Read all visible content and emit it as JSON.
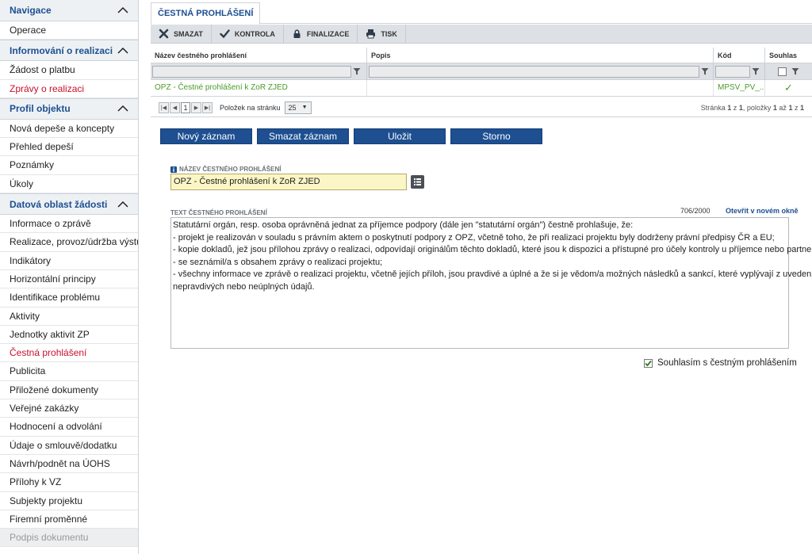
{
  "sidebar": {
    "sections": [
      {
        "title": "Navigace",
        "items": [
          {
            "label": "Operace",
            "state": "normal"
          }
        ]
      },
      {
        "title": "Informování o realizaci",
        "items": [
          {
            "label": "Žádost o platbu",
            "state": "normal"
          },
          {
            "label": "Zprávy o realizaci",
            "state": "active"
          }
        ]
      },
      {
        "title": "Profil objektu",
        "items": [
          {
            "label": "Nová depeše a koncepty",
            "state": "normal"
          },
          {
            "label": "Přehled depeší",
            "state": "normal"
          },
          {
            "label": "Poznámky",
            "state": "normal"
          },
          {
            "label": "Úkoly",
            "state": "normal"
          }
        ]
      },
      {
        "title": "Datová oblast žádosti",
        "items": [
          {
            "label": "Informace o zprávě",
            "state": "normal"
          },
          {
            "label": "Realizace, provoz/údržba výstupu",
            "state": "normal"
          },
          {
            "label": "Indikátory",
            "state": "normal"
          },
          {
            "label": "Horizontální principy",
            "state": "normal"
          },
          {
            "label": "Identifikace problému",
            "state": "normal"
          },
          {
            "label": "Aktivity",
            "state": "normal"
          },
          {
            "label": "Jednotky aktivit ZP",
            "state": "normal"
          },
          {
            "label": "Čestná prohlášení",
            "state": "active"
          },
          {
            "label": "Publicita",
            "state": "normal"
          },
          {
            "label": "Přiložené dokumenty",
            "state": "normal"
          },
          {
            "label": "Veřejné zakázky",
            "state": "normal"
          },
          {
            "label": "Hodnocení a odvolání",
            "state": "normal"
          },
          {
            "label": "Údaje o smlouvě/dodatku",
            "state": "normal"
          },
          {
            "label": "Návrh/podnět na ÚOHS",
            "state": "normal"
          },
          {
            "label": "Přílohy k VZ",
            "state": "normal"
          },
          {
            "label": "Subjekty projektu",
            "state": "normal"
          },
          {
            "label": "Firemní proměnné",
            "state": "normal"
          },
          {
            "label": "Podpis dokumentu",
            "state": "disabled"
          }
        ]
      }
    ]
  },
  "tab": {
    "label": "ČESTNÁ PROHLÁŠENÍ"
  },
  "toolbar": {
    "delete": "SMAZAT",
    "check": "KONTROLA",
    "finalize": "FINALIZACE",
    "print": "TISK"
  },
  "grid": {
    "columns": {
      "name": "Název čestného prohlášení",
      "desc": "Popis",
      "code": "Kód",
      "agree": "Souhlas"
    },
    "row": {
      "name": "OPZ - Čestné prohlášení k ZoR ZJED",
      "desc": "",
      "code": "MPSV_PV_...",
      "agree": "✓"
    }
  },
  "pager": {
    "current_page": "1",
    "per_page_label": "Položek na stránku",
    "per_page_value": "25",
    "summary_page": "Stránka",
    "summary_page_num": "1",
    "summary_of": "z",
    "summary_total_pages": "1",
    "summary_items": ", položky",
    "summary_from": "1",
    "summary_to_word": "až",
    "summary_to": "1",
    "summary_total_items": "1"
  },
  "buttons": {
    "new": "Nový záznam",
    "delete": "Smazat záznam",
    "save": "Uložit",
    "cancel": "Storno"
  },
  "form": {
    "name_label": "NÁZEV ČESTNÉHO PROHLÁŠENÍ",
    "name_value": "OPZ - Čestné prohlášení k ZoR ZJED",
    "text_label": "TEXT ČESTNÉHO PROHLÁŠENÍ",
    "counter": "706/2000",
    "open_link": "Otevřít v novém okně",
    "text_lines": [
      "Statutární orgán, resp. osoba oprávněná jednat za příjemce podpory (dále jen \"statutární orgán\") čestně prohlašuje, že:",
      "- projekt je realizován v souladu s právním aktem o poskytnutí podpory z OPZ, včetně toho, že při realizaci projektu byly dodrženy právní předpisy ČR a EU;",
      "- kopie dokladů, jež jsou přílohou zprávy o realizaci, odpovídají originálům těchto dokladů, které jsou k dispozici a přístupné pro účely kontroly u příjemce nebo partnera;",
      "- se seznámil/a s obsahem zprávy o realizaci projektu;",
      "- všechny informace ve zprávě o realizaci projektu, včetně jejích příloh, jsou pravdivé a úplné a že si je vědom/a možných následků a sankcí, které vyplývají z uvedení",
      "nepravdivých nebo neúplných údajů."
    ],
    "agree_label": "Souhlasím s čestným prohlášením",
    "agree_checked": true
  },
  "colors": {
    "accent": "#1d4f91",
    "active_red": "#c8102e",
    "green": "#4c9a2a",
    "field_yellow": "#fbf6c6"
  }
}
